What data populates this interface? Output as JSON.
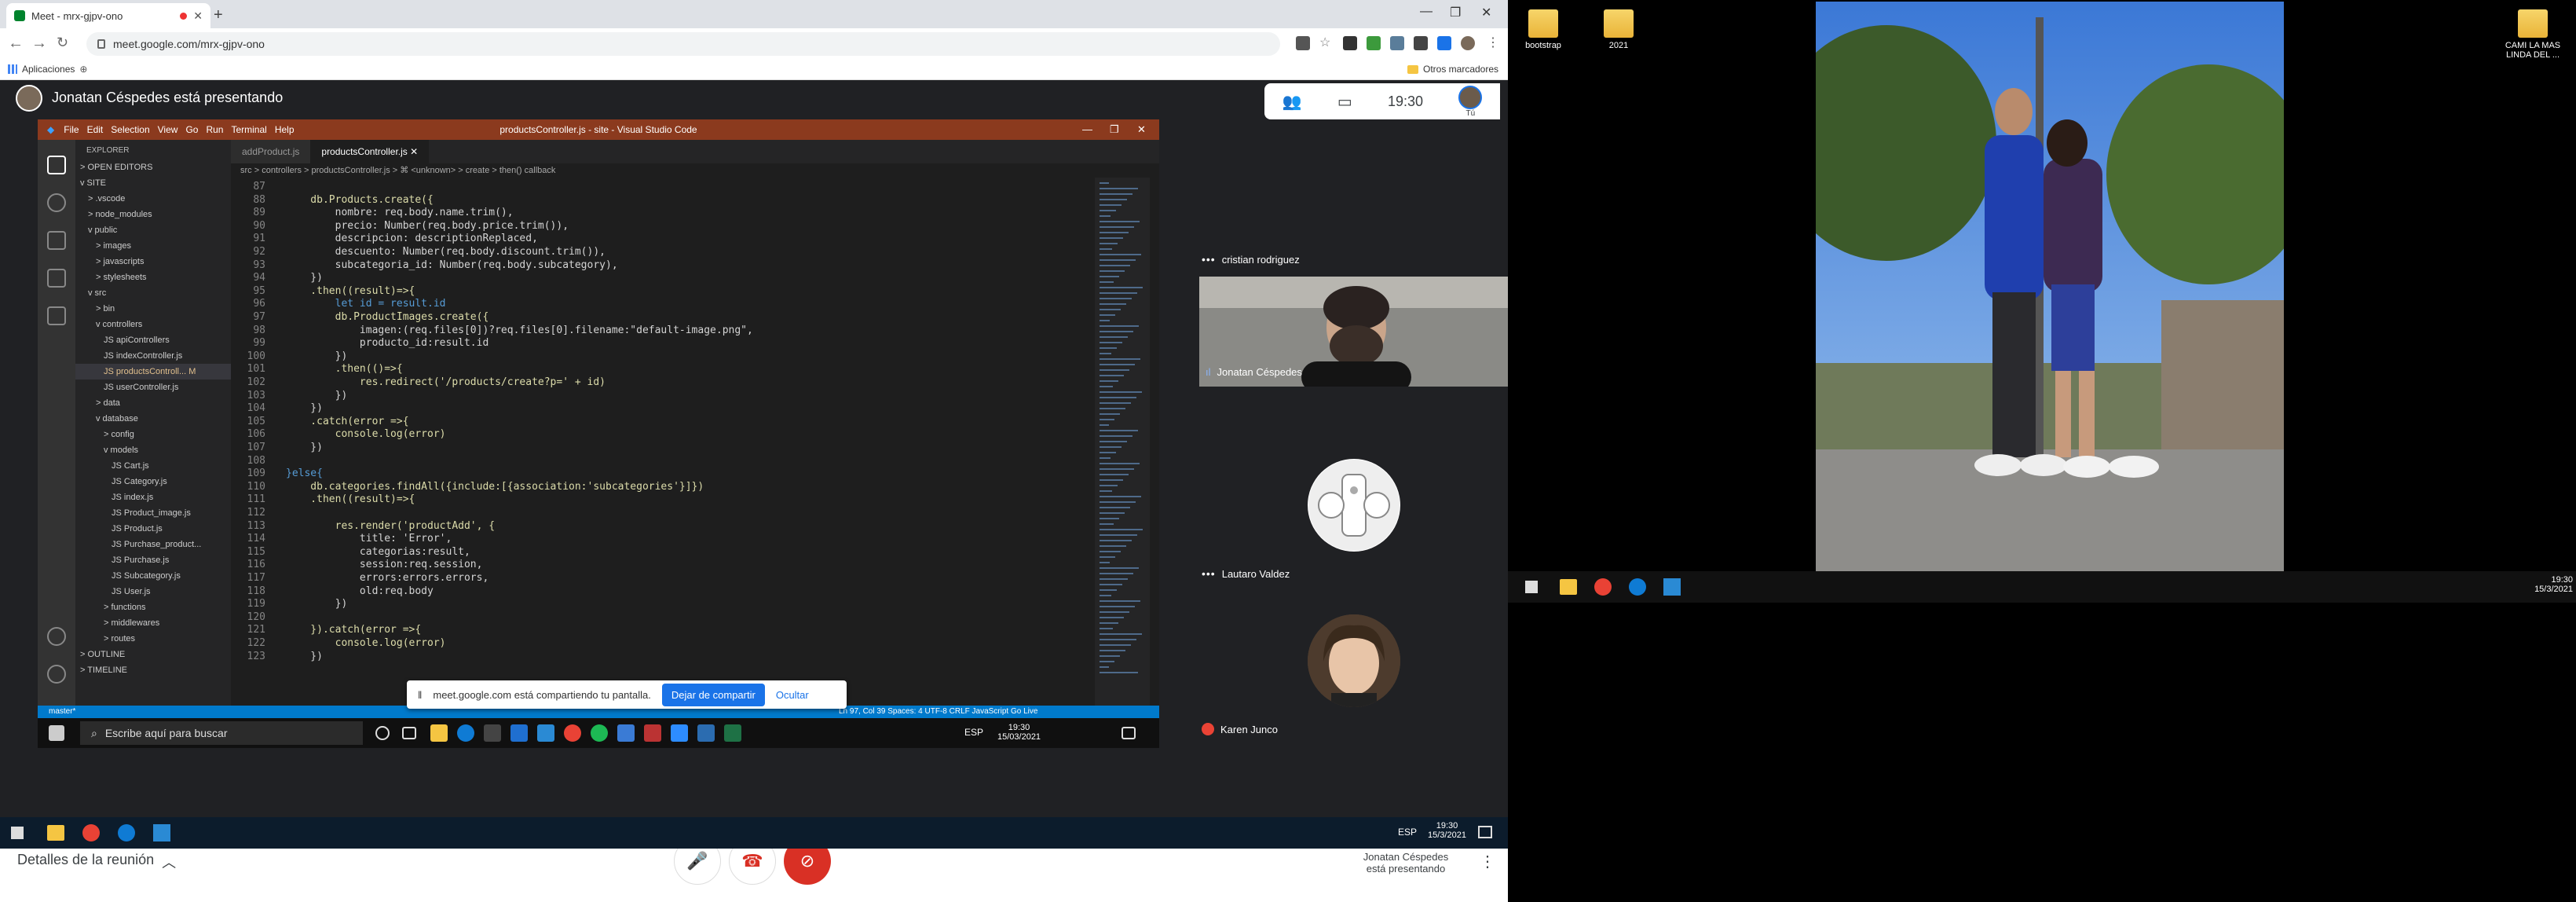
{
  "browser": {
    "tab_title": "Meet - mrx-gjpv-ono",
    "url": "meet.google.com/mrx-gjpv-ono",
    "bookmarks_apps": "Aplicaciones",
    "bookmarks_other": "Otros marcadores"
  },
  "meet": {
    "presenting_text": "Jonatan Céspedes está presentando",
    "time": "19:30",
    "me_label": "Tú",
    "details_label": "Detalles de la reunión",
    "presenter_label_1": "Jonatan Céspedes",
    "presenter_label_2": "está presentando",
    "participants": [
      "cristian rodriguez",
      "Jonatan Céspedes",
      "Lautaro Valdez",
      "Karen Junco"
    ]
  },
  "vscode": {
    "menu": [
      "File",
      "Edit",
      "Selection",
      "View",
      "Go",
      "Run",
      "Terminal",
      "Help"
    ],
    "window_title": "productsController.js - site - Visual Studio Code",
    "tabs": [
      "addProduct.js",
      "productsController.js"
    ],
    "breadcrumb": "src > controllers > productsController.js > ⌘ <unknown> > create > then() callback",
    "explorer_title": "EXPLORER",
    "explorer": [
      {
        "label": "> OPEN EDITORS",
        "indent": 0
      },
      {
        "label": "v SITE",
        "indent": 0
      },
      {
        "label": "> .vscode",
        "indent": 1
      },
      {
        "label": "> node_modules",
        "indent": 1
      },
      {
        "label": "v public",
        "indent": 1
      },
      {
        "label": "> images",
        "indent": 2
      },
      {
        "label": "> javascripts",
        "indent": 2
      },
      {
        "label": "> stylesheets",
        "indent": 2
      },
      {
        "label": "v src",
        "indent": 1
      },
      {
        "label": "> bin",
        "indent": 2
      },
      {
        "label": "v controllers",
        "indent": 2
      },
      {
        "label": "JS apiControllers",
        "indent": 3
      },
      {
        "label": "JS indexController.js",
        "indent": 3
      },
      {
        "label": "JS productsControll... M",
        "indent": 3
      },
      {
        "label": "JS userController.js",
        "indent": 3
      },
      {
        "label": "> data",
        "indent": 2
      },
      {
        "label": "v database",
        "indent": 2
      },
      {
        "label": "> config",
        "indent": 3
      },
      {
        "label": "v models",
        "indent": 3
      },
      {
        "label": "JS Cart.js",
        "indent": 4
      },
      {
        "label": "JS Category.js",
        "indent": 4
      },
      {
        "label": "JS index.js",
        "indent": 4
      },
      {
        "label": "JS Product_image.js",
        "indent": 4
      },
      {
        "label": "JS Product.js",
        "indent": 4
      },
      {
        "label": "JS Purchase_product...",
        "indent": 4
      },
      {
        "label": "JS Purchase.js",
        "indent": 4
      },
      {
        "label": "JS Subcategory.js",
        "indent": 4
      },
      {
        "label": "JS User.js",
        "indent": 4
      },
      {
        "label": "> functions",
        "indent": 3
      },
      {
        "label": "> middlewares",
        "indent": 3
      },
      {
        "label": "> routes",
        "indent": 3
      },
      {
        "label": "> OUTLINE",
        "indent": 0
      },
      {
        "label": "> TIMELINE",
        "indent": 0
      }
    ],
    "code": [
      {
        "n": "87",
        "t": ""
      },
      {
        "n": "88",
        "t": "    db.Products.create({"
      },
      {
        "n": "89",
        "t": "        nombre: req.body.name.trim(),"
      },
      {
        "n": "90",
        "t": "        precio: Number(req.body.price.trim()),"
      },
      {
        "n": "91",
        "t": "        descripcion: descriptionReplaced,"
      },
      {
        "n": "92",
        "t": "        descuento: Number(req.body.discount.trim()),"
      },
      {
        "n": "93",
        "t": "        subcategoria_id: Number(req.body.subcategory),"
      },
      {
        "n": "94",
        "t": "    })"
      },
      {
        "n": "95",
        "t": "    .then((result)=>{"
      },
      {
        "n": "96",
        "t": "        let id = result.id"
      },
      {
        "n": "97",
        "t": "        db.ProductImages.create({"
      },
      {
        "n": "98",
        "t": "            imagen:(req.files[0])?req.files[0].filename:\"default-image.png\","
      },
      {
        "n": "99",
        "t": "            producto_id:result.id"
      },
      {
        "n": "100",
        "t": "        })"
      },
      {
        "n": "101",
        "t": "        .then(()=>{"
      },
      {
        "n": "102",
        "t": "            res.redirect('/products/create?p=' + id)"
      },
      {
        "n": "103",
        "t": "        })"
      },
      {
        "n": "104",
        "t": "    })"
      },
      {
        "n": "105",
        "t": "    .catch(error =>{"
      },
      {
        "n": "106",
        "t": "        console.log(error)"
      },
      {
        "n": "107",
        "t": "    })"
      },
      {
        "n": "108",
        "t": ""
      },
      {
        "n": "109",
        "t": "}else{"
      },
      {
        "n": "110",
        "t": "    db.categories.findAll({include:[{association:'subcategories'}]})"
      },
      {
        "n": "111",
        "t": "    .then((result)=>{"
      },
      {
        "n": "112",
        "t": ""
      },
      {
        "n": "113",
        "t": "        res.render('productAdd', {"
      },
      {
        "n": "114",
        "t": "            title: 'Error',"
      },
      {
        "n": "115",
        "t": "            categorias:result,"
      },
      {
        "n": "116",
        "t": "            session:req.session,"
      },
      {
        "n": "117",
        "t": "            errors:errors.errors,"
      },
      {
        "n": "118",
        "t": "            old:req.body"
      },
      {
        "n": "119",
        "t": "        })"
      },
      {
        "n": "120",
        "t": ""
      },
      {
        "n": "121",
        "t": "    }).catch(error =>{"
      },
      {
        "n": "122",
        "t": "        console.log(error)"
      },
      {
        "n": "123",
        "t": "    })"
      }
    ],
    "status_left": "master*",
    "status_right": "Ln 97, Col 39   Spaces: 4   UTF-8   CRLF   JavaScript   Go Live"
  },
  "share_bar": {
    "message": "meet.google.com está compartiendo tu pantalla.",
    "stop_label": "Dejar de compartir",
    "hide_label": "Ocultar"
  },
  "win_taskbar": {
    "search_placeholder": "Escribe aquí para buscar",
    "lang": "ESP",
    "time": "19:30",
    "date": "15/03/2021"
  },
  "taskbar2": {
    "lang": "ESP",
    "time": "19:30",
    "date": "15/3/2021"
  },
  "desktop": {
    "icons": [
      "bootstrap",
      "2021",
      "CAMI LA MAS LINDA DEL ..."
    ],
    "time": "19:30",
    "date": "15/3/2021"
  }
}
